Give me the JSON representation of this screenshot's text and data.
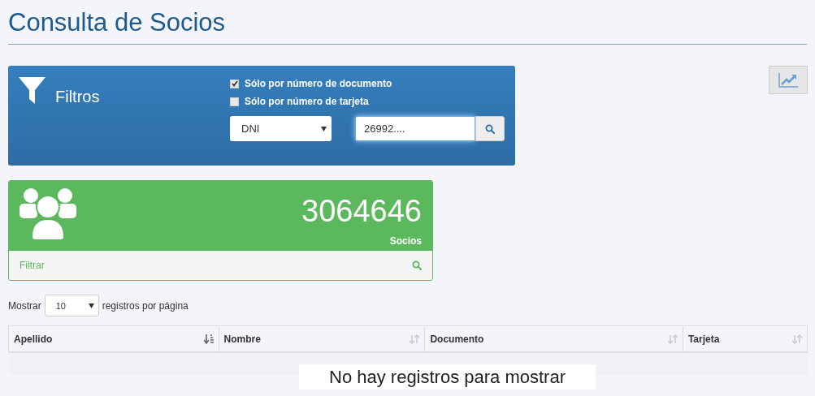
{
  "page_title": "Consulta de Socios",
  "filters": {
    "title": "Filtros",
    "options": [
      {
        "label": "Sólo por número de documento",
        "checked": true
      },
      {
        "label": "Sólo por número de tarjeta",
        "checked": false
      }
    ],
    "doc_type": "DNI",
    "search_value": "26992...."
  },
  "stats": {
    "count": "3064646",
    "label": "Socios",
    "filter_link": "Filtrar"
  },
  "page_size": {
    "prefix": "Mostrar",
    "value": "10",
    "suffix": "registros por página"
  },
  "table": {
    "columns": [
      {
        "label": "Apellido",
        "sorted": true
      },
      {
        "label": "Nombre",
        "sorted": false
      },
      {
        "label": "Documento",
        "sorted": false
      },
      {
        "label": "Tarjeta",
        "sorted": false
      }
    ],
    "empty_message": "No hay registros para mostrar"
  }
}
